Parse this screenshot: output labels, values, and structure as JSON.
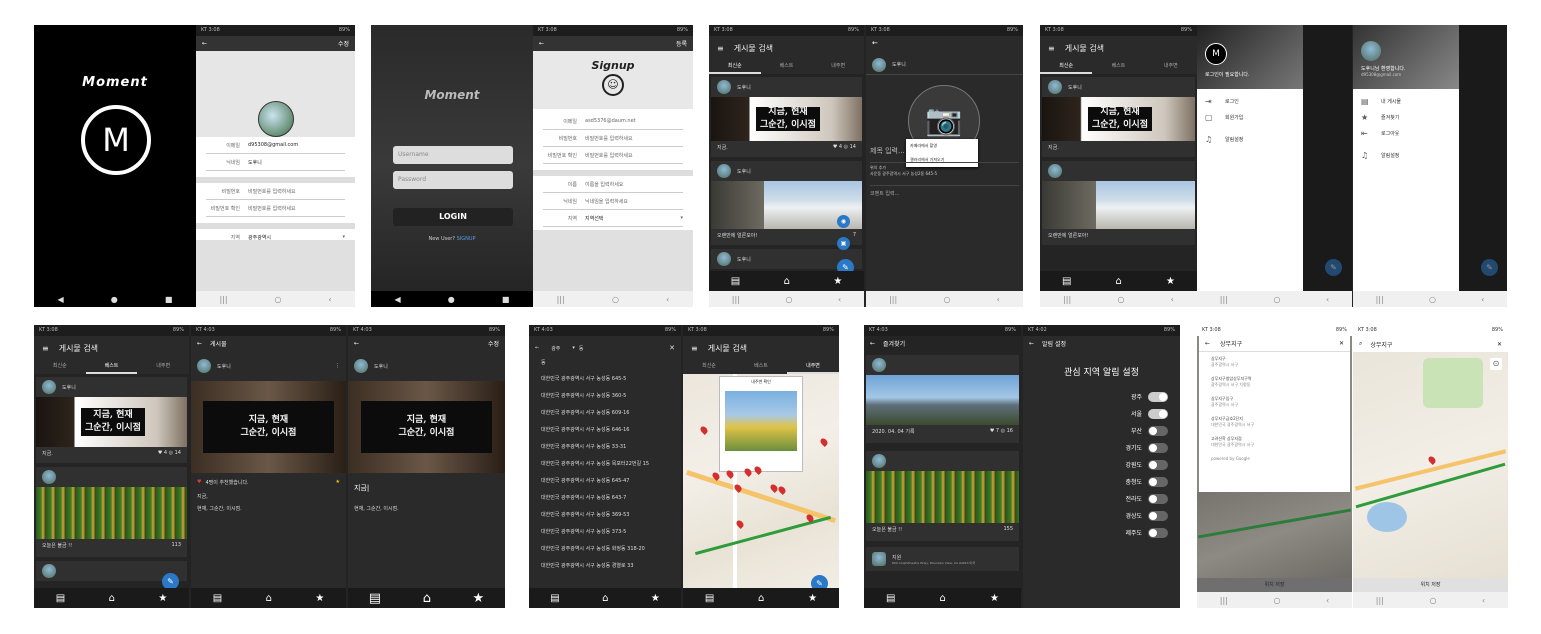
{
  "status": {
    "carrier": "KT 3:08",
    "carrier2": "KT 4:03",
    "carrier3": "KT 4:02",
    "battery": "89%"
  },
  "splash": {
    "brand": "Moment",
    "logo": "M"
  },
  "profile": {
    "action": "수정",
    "email": "d95308@gmail.com",
    "email_label": "이메일",
    "nick_label": "닉네임",
    "nick": "도후니",
    "pw_label": "비밀번호",
    "pw_ph": "비밀번호를 입력하세요",
    "pwc_label": "비밀번호 확인",
    "pwc_ph": "비밀번호를 입력하세요",
    "region_label": "지역",
    "region": "광주광역시"
  },
  "login": {
    "brand": "Moment",
    "user_ph": "Username",
    "pw_ph": "Password",
    "btn": "LOGIN",
    "new_user": "New User?",
    "signup": "SIGNUP"
  },
  "signup": {
    "title": "Signup",
    "action": "등록",
    "rows": [
      {
        "l": "이메일",
        "v": "asd5376@daum.net"
      },
      {
        "l": "비밀번호",
        "v": "비밀번호를 입력하세요"
      },
      {
        "l": "비밀번호 확인",
        "v": "비밀번호를 입력하세요"
      },
      {
        "l": "이름",
        "v": "이름을 입력하세요"
      },
      {
        "l": "닉네임",
        "v": "닉네임을 입력하세요"
      },
      {
        "l": "지역",
        "v": "지역선택"
      }
    ]
  },
  "feed": {
    "title": "게시물 검색",
    "tabs": [
      "최신순",
      "베스트",
      "내주변"
    ],
    "user": "도후니",
    "addr": "대한민국 광주광역시 서구 농성2동 645-5",
    "sign1": "지금, 현재",
    "sign2": "그순간, 이시점",
    "cap1": "지금.",
    "cnt1": "4",
    "cnt1b": "14",
    "cap2": "오랜만에 얼른모아!",
    "cnt2": "7",
    "cap3": "오늘은 불금 !!",
    "cnt3": "113"
  },
  "write": {
    "user": "도후니",
    "menu1": "카메라에서 촬영",
    "menu2": "갤러리에서 가져오기",
    "title_ph": "제목 입력...",
    "loc_label": "위치 추가",
    "loc": "사운동 광주광역시 서구 농성2동 645-5",
    "content_ph": "코멘트 입력..."
  },
  "drawer": {
    "guest": "로그인이 필요합니다.",
    "login": "로그인",
    "join": "회원가입",
    "alarm": "알림설정",
    "welcome": "도후니님 환영합니다.",
    "mail": "d95308@gmail.com",
    "mine": "내 게시물",
    "fav": "즐겨찾기",
    "logout": "로그아웃"
  },
  "detail": {
    "title": "게시물",
    "action": "수정",
    "likes": "4명이 추천했습니다.",
    "t": "지금,",
    "c": "현재, 그순간, 이시점.",
    "edit": "지금|"
  },
  "search": {
    "sido": "광주",
    "gu": "동",
    "items": [
      "대한민국 광주광역시 서구 농성동 645-5",
      "대한민국 광주광역시 서구 농성동 360-5",
      "대한민국 광주광역시 서구 농성동 609-16",
      "대한민국 광주광역시 서구 농성동 646-16",
      "대한민국 광주광역시 서구 농성동 33-31",
      "대한민국 광주광역시 서구 농성동 목포터22번길 15",
      "대한민국 광주광역시 서구 농성동 645-47",
      "대한민국 광주광역시 서구 농성동 643-7",
      "대한민국 광주광역시 서구 농성동 369-53",
      "대한민국 광주광역시 서구 농성동 373-5",
      "대한민국 광주광역시 서구 농성동 화정동 318-20",
      "대한민국 광주광역시 서구 농성동 경열로 33"
    ]
  },
  "map": {
    "tab": "내주변",
    "popup": "내주변 확인"
  },
  "favs": {
    "title": "즐겨찾기",
    "date": "2020. 04. 04 기록",
    "c1": "7",
    "c2": "16",
    "cap": "오늘은 불금 !!",
    "c3": "155",
    "mapu": "지원",
    "mapaddr": "800 Amphitheatre Pkwy, Mountain View, CA 94043 미국"
  },
  "alarm": {
    "title": "알림 설정",
    "head": "관심 지역 알림 설정",
    "regions": [
      {
        "n": "광주",
        "on": true
      },
      {
        "n": "서울",
        "on": true
      },
      {
        "n": "부산",
        "on": false
      },
      {
        "n": "경기도",
        "on": false
      },
      {
        "n": "강원도",
        "on": false
      },
      {
        "n": "충청도",
        "on": false
      },
      {
        "n": "전라도",
        "on": false
      },
      {
        "n": "경상도",
        "on": false
      },
      {
        "n": "제주도",
        "on": false
      }
    ]
  },
  "places": {
    "q": "상무지구",
    "items": [
      {
        "a": "상무지구",
        "b": "광주광역시 서구"
      },
      {
        "a": "상무지구청암상무지구역",
        "b": "광주광역시 서구 치평동"
      },
      {
        "a": "상무지구입구",
        "b": "광주광역시 서구"
      },
      {
        "a": "상무지구금호2단지",
        "b": "대한민국 광주광역시 서구"
      },
      {
        "a": "고려신학 상무지점",
        "b": "대한민국 광주광역시 서구"
      }
    ],
    "powered": "powered by Google",
    "confirm": "위치 저장",
    "mapq": "상무지구",
    "confirm2": "위치 저장"
  }
}
